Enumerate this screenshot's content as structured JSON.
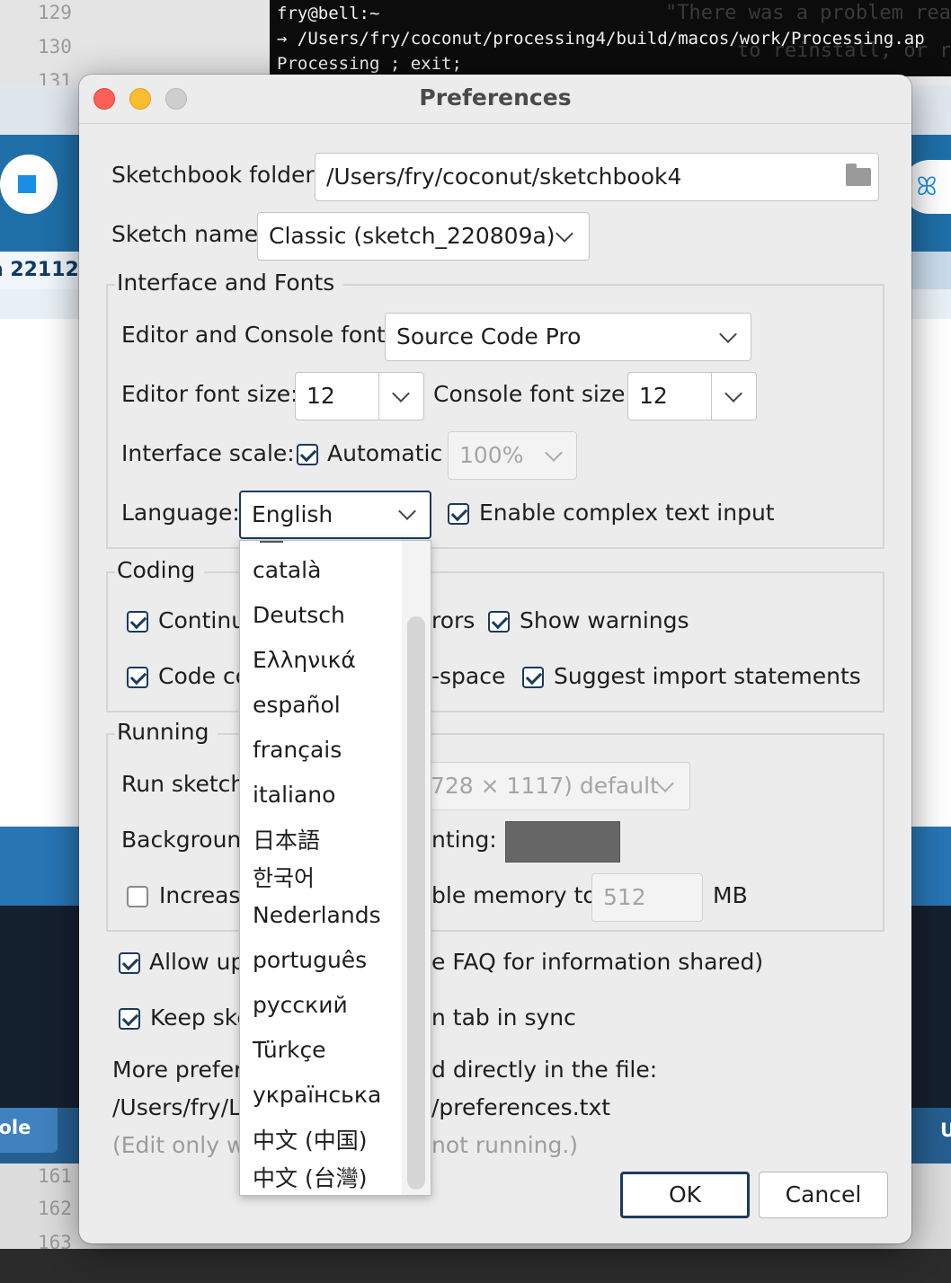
{
  "background": {
    "line_numbers_top": [
      "129",
      "130",
      "131"
    ],
    "line_numbers_bottom": [
      "161",
      "162",
      "163"
    ],
    "terminal": {
      "line1": "fry@bell:~",
      "line2": "→ /Users/fry/coconut/processing4/build/macos/work/Processing.ap",
      "line3": "Processing ; exit;",
      "ghost1": "\"There was a problem reading the langu",
      "ghost2": "to reinstall, or report it the pr"
    },
    "tab_label": "h 22112",
    "console_tab": "sole",
    "console_right": "U"
  },
  "dialog": {
    "title": "Preferences",
    "sketchbook": {
      "label": "Sketchbook folder",
      "value": "/Users/fry/coconut/sketchbook4"
    },
    "sketch_name": {
      "label": "Sketch name",
      "value": "Classic (sketch_220809a)"
    },
    "interface": {
      "title": "Interface and Fonts",
      "font_label": "Editor and Console font:",
      "font_value": "Source Code Pro",
      "editor_size_label": "Editor font size:",
      "editor_size_value": "12",
      "console_size_label": "Console font size:",
      "console_size_value": "12",
      "scale_label": "Interface scale:",
      "scale_auto_label": "Automatic",
      "scale_value": "100%",
      "language_label": "Language:",
      "language_value": "English",
      "complex_input_label": "Enable complex text input"
    },
    "coding": {
      "title": "Coding",
      "continuous_label": "Continu",
      "errors_label": "rors",
      "warnings_label": "Show warnings",
      "code_completion_label": "Code co",
      "ctrl_space_label": "-space",
      "suggest_imports_label": "Suggest import statements"
    },
    "running": {
      "title": "Running",
      "run_sketches_label": "Run sketch",
      "display_value": "728 × 1117) default",
      "background_label": "Background",
      "presenting_label": "nting:",
      "increase_label": "Increase",
      "memory_label": "ble memory to",
      "memory_value": "512",
      "memory_unit": "MB"
    },
    "allow_updates_label": "Allow up",
    "faq_label": "e FAQ for information shared)",
    "keep_sketch_label": "Keep ske",
    "tab_sync_label": "n tab in sync",
    "more_prefs_label": "More prefere",
    "edited_label": "d directly in the file:",
    "path_start": "/Users/fry/L",
    "path_end": "/preferences.txt",
    "edit_note_start": "(Edit only wl",
    "edit_note_end": "not running.)",
    "ok_label": "OK",
    "cancel_label": "Cancel"
  },
  "language_menu": {
    "items": [
      "català",
      "Deutsch",
      "Ελληνικά",
      "español",
      "français",
      "italiano",
      "日本語",
      "한국어",
      "Nederlands",
      "português",
      "русский",
      "Türkçe",
      "українська",
      "中文 (中国)",
      "中文 (台灣)"
    ]
  }
}
